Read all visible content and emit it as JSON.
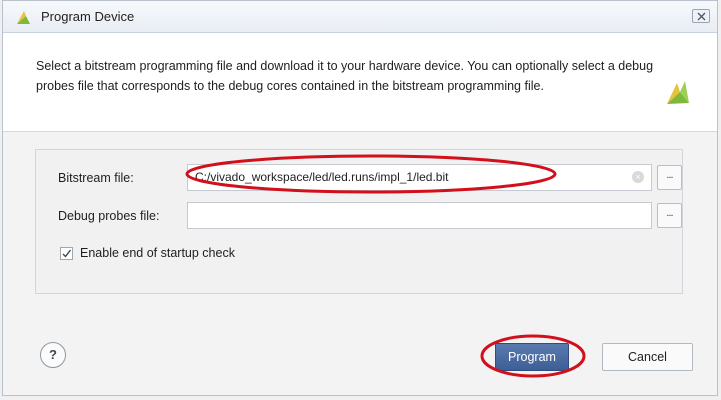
{
  "window": {
    "title": "Program Device",
    "close_glyph": "⊠"
  },
  "description": "Select a bitstream programming file and download it to your hardware device. You can optionally select a debug probes file that corresponds to the debug cores contained in the bitstream programming file.",
  "form": {
    "bitstream_label": "Bitstream file:",
    "bitstream_value": "C:/vivado_workspace/led/led.runs/impl_1/led.bit",
    "debug_label": "Debug probes file:",
    "debug_value": "",
    "browse_label": "...",
    "clear_glyph": "×",
    "startup_check_label": "Enable end of startup check",
    "startup_check_checked": true
  },
  "footer": {
    "help_label": "?",
    "program_label": "Program",
    "cancel_label": "Cancel"
  },
  "colors": {
    "annotation_red": "#d1101c",
    "primary_button": "#4a6ca4",
    "logo_green": "#7fb83a",
    "logo_yellow": "#e7c23b"
  }
}
